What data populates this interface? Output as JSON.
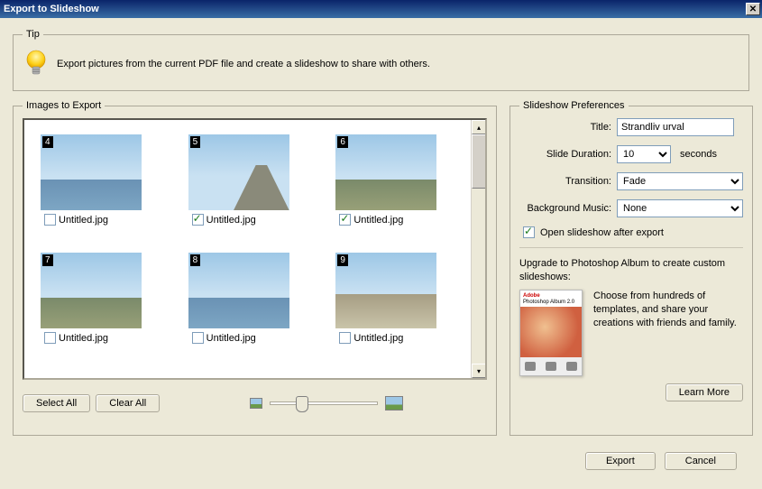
{
  "window": {
    "title": "Export to Slideshow"
  },
  "tip": {
    "legend": "Tip",
    "text": "Export pictures from the current PDF file and create a slideshow to share with others."
  },
  "images": {
    "legend": "Images to Export",
    "select_all": "Select All",
    "clear_all": "Clear All",
    "items": [
      {
        "num": "4",
        "caption": "Untitled.jpg",
        "checked": false,
        "bg": "water"
      },
      {
        "num": "5",
        "caption": "Untitled.jpg",
        "checked": true,
        "bg": "road"
      },
      {
        "num": "6",
        "caption": "Untitled.jpg",
        "checked": true,
        "bg": "ground"
      },
      {
        "num": "7",
        "caption": "Untitled.jpg",
        "checked": false,
        "bg": "ground"
      },
      {
        "num": "8",
        "caption": "Untitled.jpg",
        "checked": false,
        "bg": "water"
      },
      {
        "num": "9",
        "caption": "Untitled.jpg",
        "checked": false,
        "bg": "beach"
      }
    ]
  },
  "prefs": {
    "legend": "Slideshow Preferences",
    "title_label": "Title:",
    "title_value": "Strandliv urval",
    "duration_label": "Slide Duration:",
    "duration_value": "10",
    "duration_suffix": "seconds",
    "transition_label": "Transition:",
    "transition_value": "Fade",
    "music_label": "Background Music:",
    "music_value": "None",
    "open_after_label": "Open slideshow after export",
    "open_after_checked": true,
    "upgrade_intro": "Upgrade to Photoshop Album to create custom slideshows:",
    "upgrade_blurb": "Choose from hundreds of templates, and share your creations with friends and family.",
    "boxshot_brand": "Adobe",
    "boxshot_product": "Photoshop Album 2.0",
    "learn_more": "Learn More"
  },
  "footer": {
    "export": "Export",
    "cancel": "Cancel"
  }
}
